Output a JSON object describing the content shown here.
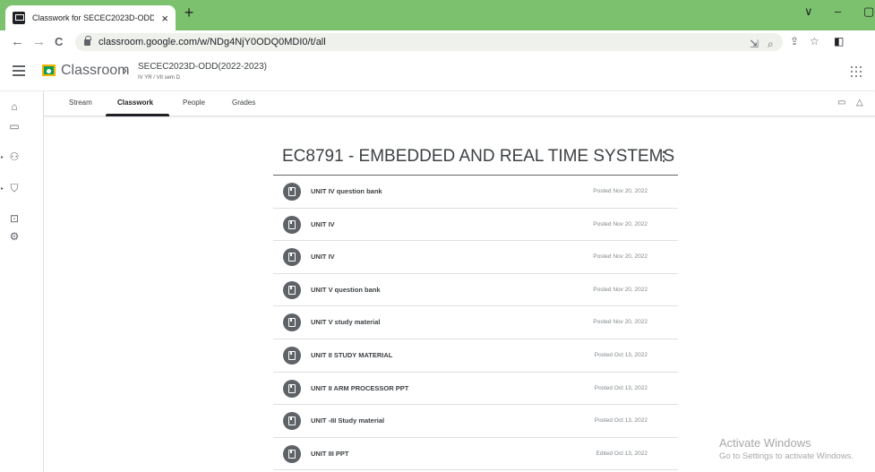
{
  "browser": {
    "tab_title": "Classwork for SECEC2023D-ODD(",
    "tab_close": "×",
    "new_tab": "+",
    "url": "classroom.google.com/w/NDg4NjY0ODQ0MDI0/t/all",
    "back": "←",
    "forward": "→",
    "reload": "C",
    "window_controls": {
      "collapse": "∨",
      "minimize": "–",
      "restore": "▢"
    },
    "omni_icons": {
      "install": "⇲",
      "zoom": "⌕",
      "share": "⇪",
      "bookmark": "☆",
      "sidepanel": "◧"
    }
  },
  "header": {
    "app_name": "Classroom",
    "separator": "›",
    "class_title": "SECEC2023D-ODD(2022-2023)",
    "class_subtitle": "IV YR / VII sem D"
  },
  "rail": {
    "caret": "▸",
    "icons": [
      "home-icon",
      "calendar-icon",
      "people-icon",
      "school-icon",
      "archive-icon",
      "settings-icon"
    ],
    "glyphs": {
      "home": "⌂",
      "calendar": "▭",
      "people": "⚇",
      "school": "⛉",
      "archive": "⊡",
      "settings": "⚙"
    }
  },
  "tabs": [
    {
      "label": "Stream",
      "active": false
    },
    {
      "label": "Classwork",
      "active": true
    },
    {
      "label": "People",
      "active": false
    },
    {
      "label": "Grades",
      "active": false
    }
  ],
  "tab_icons": {
    "calendar": "▭",
    "drive": "△"
  },
  "topic": {
    "title": "EC8791 - EMBEDDED AND REAL TIME SYSTEMS",
    "menu": "⋮",
    "items": [
      {
        "title": "UNIT IV question bank",
        "date": "Posted Nov 20, 2022"
      },
      {
        "title": "UNIT IV",
        "date": "Posted Nov 20, 2022"
      },
      {
        "title": "UNIT IV",
        "date": "Posted Nov 20, 2022"
      },
      {
        "title": "UNIT V question bank",
        "date": "Posted Nov 20, 2022"
      },
      {
        "title": "UNIT V study material",
        "date": "Posted Nov 20, 2022"
      },
      {
        "title": "UNIT II STUDY MATERIAL",
        "date": "Posted Oct 13, 2022"
      },
      {
        "title": "UNIT II ARM PROCESSOR PPT",
        "date": "Posted Oct 13, 2022"
      },
      {
        "title": "UNIT -III Study material",
        "date": "Posted Oct 13, 2022"
      },
      {
        "title": "UNIT III PPT",
        "date": "Edited Oct 13, 2022"
      }
    ]
  },
  "watermark": {
    "title": "Activate Windows",
    "subtitle": "Go to Settings to activate Windows."
  },
  "colors": {
    "tab_strip": "#7cc26e",
    "logo_green": "#0f9d58",
    "logo_yellow": "#f4b400",
    "text": "#3c4043"
  }
}
